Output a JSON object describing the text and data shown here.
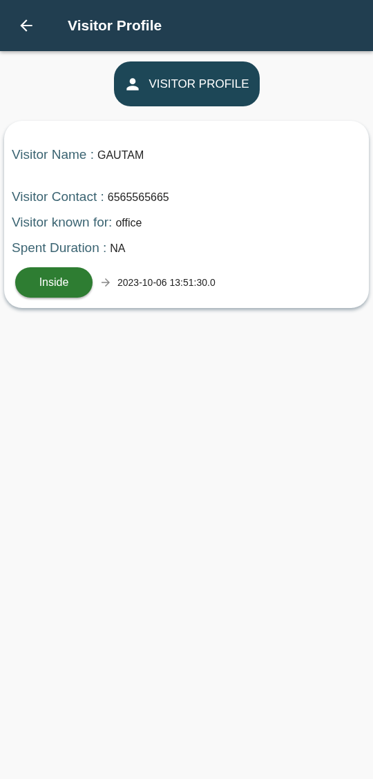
{
  "app_bar": {
    "title": "Visitor Profile"
  },
  "profile_button": {
    "label": "VISITOR PROFILE"
  },
  "visitor_card": {
    "fields": [
      {
        "label": "Visitor Name :",
        "value": "GAUTAM"
      },
      {
        "label": "Visitor Contact :",
        "value": "6565565665"
      },
      {
        "label": "Visitor known for:",
        "value": "office"
      },
      {
        "label": "Spent Duration :",
        "value": "NA"
      }
    ],
    "status": {
      "label": "Inside",
      "time": "2023-10-06 13:51:30.0"
    }
  }
}
